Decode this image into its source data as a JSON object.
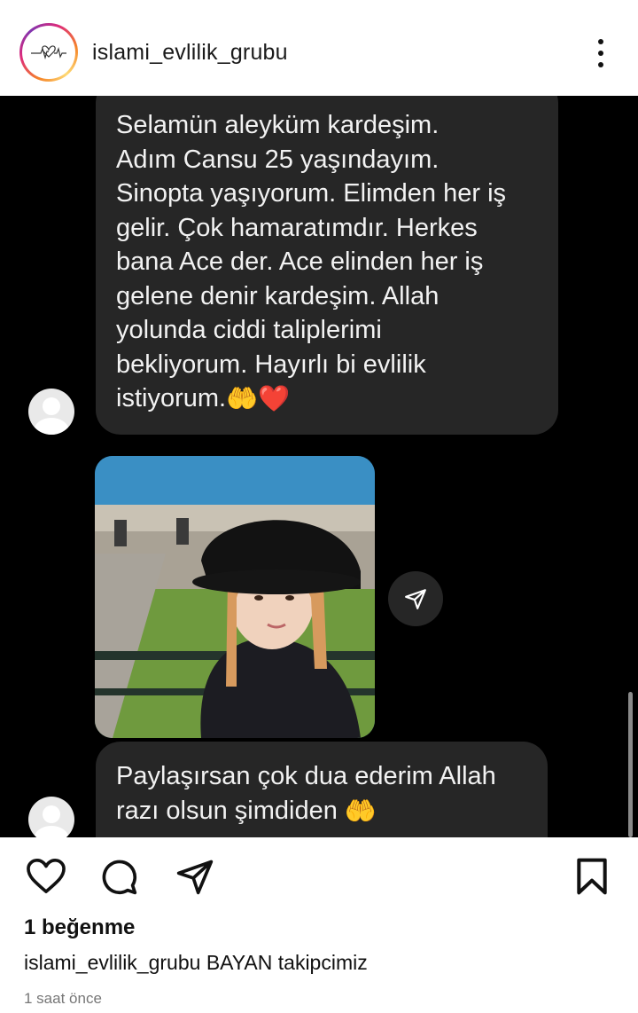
{
  "header": {
    "username": "islami_evlilik_grubu",
    "avatar_icon": "heartbeat-heart-logo",
    "more_icon": "more-vertical-icon"
  },
  "post": {
    "messages": [
      {
        "lines": [
          "Selamün aleyküm kardeşim.",
          "Adım Cansu 25 yaşındayım.",
          "Sinopta yaşıyorum. Elimden her iş",
          "gelir. Çok hamaratımdır. Herkes",
          "bana Ace der. Ace elinden her iş",
          "gelene denir kardeşim. Allah",
          "yolunda ciddi taliplerimi",
          "bekliyorum. Hayırlı bi evlilik",
          "istiyorum."
        ],
        "emojis": [
          "🤲",
          "❤️"
        ]
      },
      {
        "lines": [
          "Paylaşırsan çok dua ederim Allah",
          "razı olsun şimdiden "
        ],
        "emojis": [
          "🤲"
        ]
      }
    ],
    "photo_icon": "shared-photo",
    "share_icon": "send-icon"
  },
  "actions": {
    "like_icon": "heart-icon",
    "comment_icon": "comment-icon",
    "share_icon": "send-icon",
    "save_icon": "bookmark-icon"
  },
  "likes_text": "1 beğenme",
  "caption": {
    "username": "islami_evlilik_grubu",
    "text": "BAYAN takipcimiz"
  },
  "timestamp": "1 saat önce"
}
